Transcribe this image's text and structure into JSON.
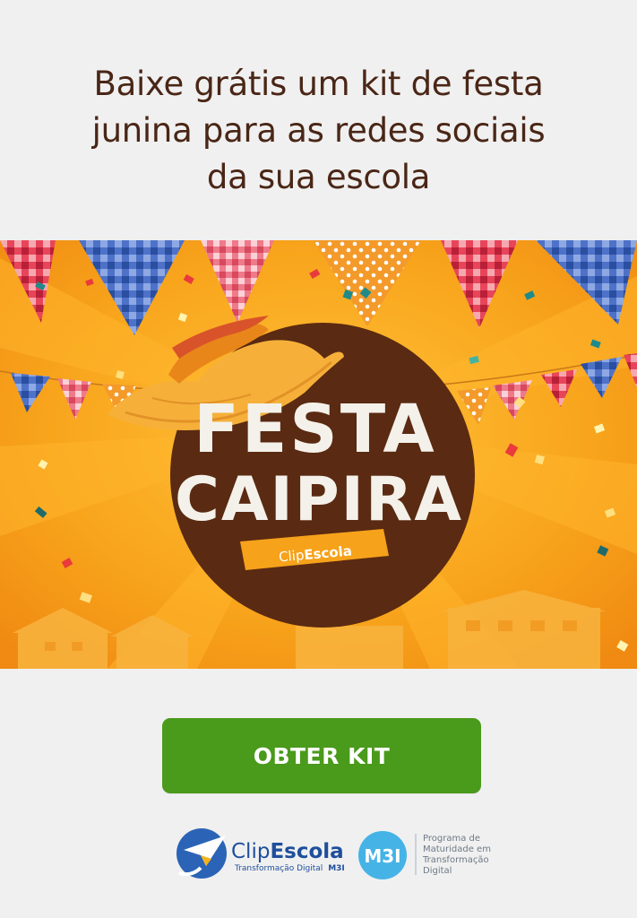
{
  "headline": {
    "line1": "Baixe grátis um kit de festa",
    "line2": "junina para as redes sociais",
    "line3": "da sua escola"
  },
  "banner": {
    "title_line1": "FESTA",
    "title_line2": "CAIPIRA",
    "ribbon_brand_part1": "Clip",
    "ribbon_brand_part2": "Escola"
  },
  "cta": {
    "label": "OBTER KIT"
  },
  "footer": {
    "clip_logo_part1": "Clip",
    "clip_logo_part2": "Escola",
    "clip_tagline": "Transformação Digital",
    "clip_tagline_mark": "M3I",
    "m3i_badge": "M3I",
    "m3i_text_line1": "Programa de",
    "m3i_text_line2": "Maturidade em",
    "m3i_text_line3": "Transformação",
    "m3i_text_line4": "Digital"
  },
  "colors": {
    "background": "#f0f0f0",
    "headline": "#4a2616",
    "banner_orange": "#f6a21a",
    "circle_brown": "#5a2a12",
    "cta_green": "#4a9a1c",
    "clip_blue": "#1e4f9c",
    "m3i_blue": "#46b3e6"
  }
}
